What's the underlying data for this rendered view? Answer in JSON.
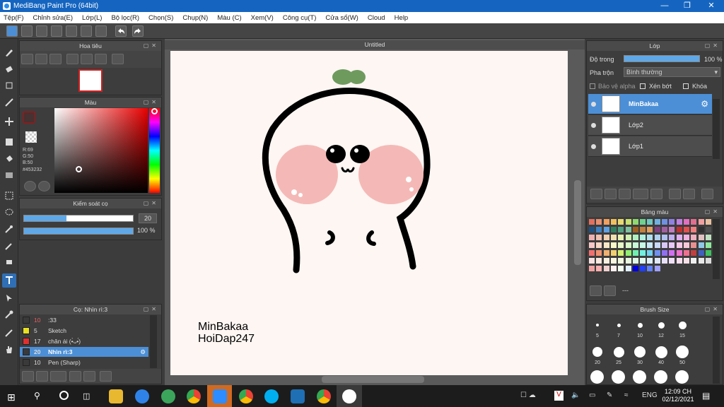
{
  "window": {
    "title": "MediBang Paint Pro (64bit)"
  },
  "menu": [
    "Tệp(F)",
    "Chỉnh sửa(E)",
    "Lớp(L)",
    "Bộ lọc(R)",
    "Chọn(S)",
    "Chụp(N)",
    "Màu (C)",
    "Xem(V)",
    "Công cụ(T)",
    "Cửa sổ(W)",
    "Cloud",
    "Help"
  ],
  "navigator": {
    "title": "Hoa tiêu"
  },
  "color_panel": {
    "title": "Màu",
    "r": "R:69",
    "g": "G:50",
    "b": "B:50",
    "hex": "#453232",
    "current_color": "#453232"
  },
  "brush_control": {
    "title": "Kiểm soát cọ",
    "size": "20",
    "opacity": "100 %",
    "size_fraction": 0.39,
    "opacity_fraction": 1.0
  },
  "brush_panel": {
    "title": "Cọ: Nhìn rì:3",
    "items": [
      {
        "size": "10",
        "name": ":33",
        "color": "#3a3a3a",
        "selected": false
      },
      {
        "size": "5",
        "name": "Sketch",
        "color": "#e8e020",
        "selected": false
      },
      {
        "size": "17",
        "name": "chân ái (•̀ᴗ•́)",
        "color": "#e03030",
        "selected": false
      },
      {
        "size": "20",
        "name": "Nhìn rì:3",
        "color": "#3a3a3a",
        "selected": true
      },
      {
        "size": "10",
        "name": "Pen (Sharp)",
        "color": "#3a3a3a",
        "selected": false
      }
    ]
  },
  "canvas": {
    "tab_title": "Untitled",
    "signature_line1": "MinBakaa",
    "signature_line2": "HoiDap247"
  },
  "layer_panel": {
    "title": "Lớp",
    "opacity_label": "Độ trong",
    "opacity_value": "100 %",
    "opacity_fraction": 1.0,
    "blend_label": "Pha trộn",
    "blend_value": "Bình thường",
    "protect_alpha": "Bảo vệ alpha",
    "clipping": "Xén bớt",
    "lock": "Khóa",
    "layers": [
      {
        "name": "MinBakaa",
        "selected": true
      },
      {
        "name": "Lớp2",
        "selected": false
      },
      {
        "name": "Lớp1",
        "selected": false
      }
    ]
  },
  "palette_panel": {
    "title": "Bảng màu",
    "footer_text": "---"
  },
  "brush_size_panel": {
    "title": "Brush Size",
    "sizes": [
      "5",
      "7",
      "10",
      "12",
      "15",
      "20",
      "25",
      "30",
      "40",
      "50"
    ]
  },
  "taskbar": {
    "lang": "ENG",
    "time": "12:09 CH",
    "date": "02/12/2021"
  }
}
